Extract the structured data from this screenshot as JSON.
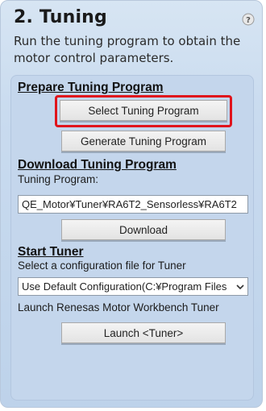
{
  "header": {
    "title": "2. Tuning",
    "description": "Run the tuning program to obtain the motor control parameters.",
    "help_icon": "question-circle-icon"
  },
  "prepare": {
    "title": "Prepare Tuning Program",
    "select_button": "Select Tuning Program",
    "generate_button": "Generate Tuning Program"
  },
  "download": {
    "title": "Download Tuning Program",
    "program_label": "Tuning Program:",
    "program_path": "QE_Motor¥Tuner¥RA6T2_Sensorless¥RA6T2",
    "download_button": "Download"
  },
  "tuner": {
    "title": "Start Tuner",
    "config_label": "Select a configuration file for Tuner",
    "config_selected": "Use Default Configuration(C:¥Program Files",
    "launch_label": "Launch Renesas Motor Workbench Tuner",
    "launch_button": "Launch <Tuner>"
  },
  "colors": {
    "highlight": "#e0141c",
    "panel_bg": "#c9dbef"
  }
}
